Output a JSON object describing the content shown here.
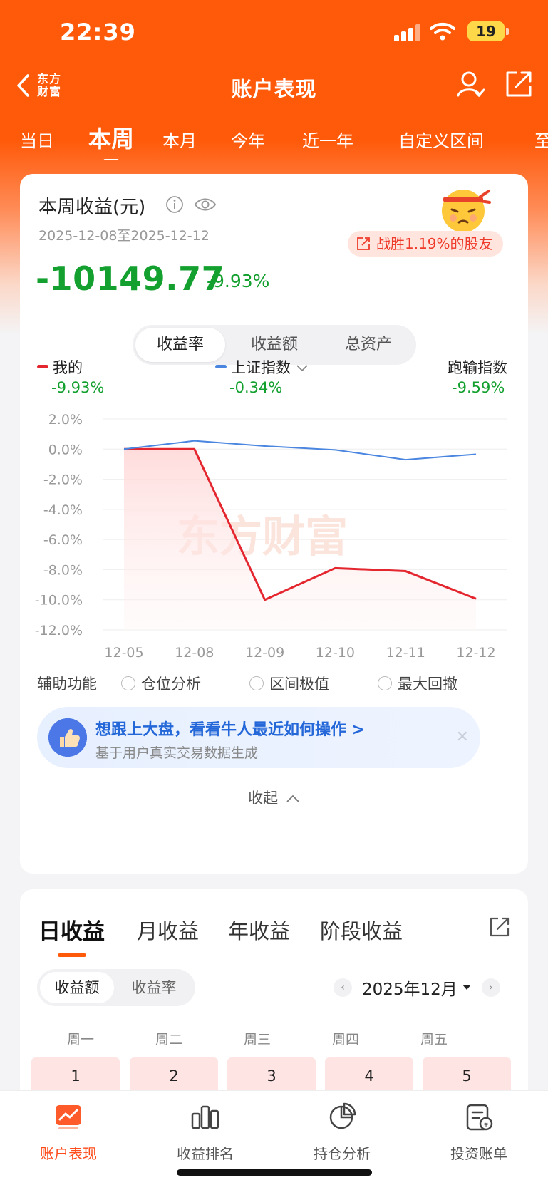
{
  "status_bar": {
    "time": "22:39",
    "battery": "19"
  },
  "navbar": {
    "logo_text": "东方财富",
    "title": "账户表现"
  },
  "period_tabs": [
    {
      "label": "当日"
    },
    {
      "label": "本周"
    },
    {
      "label": "本月"
    },
    {
      "label": "今年"
    },
    {
      "label": "近一年"
    },
    {
      "label": "自定义区间"
    },
    {
      "label": "至"
    }
  ],
  "summary": {
    "title": "本周收益(元)",
    "date_range": "2025-12-08至2025-12-12",
    "beat_text": "战胜1.19%的股友",
    "value": "-10149.77",
    "pct": "-9.93%"
  },
  "metric_tabs": [
    "收益率",
    "收益额",
    "总资产"
  ],
  "legend": [
    {
      "label": "我的",
      "value": "-9.93%",
      "color": "#e4262f"
    },
    {
      "label": "上证指数",
      "value": "-0.34%",
      "color": "#4a86e0"
    },
    {
      "label": "跑输指数",
      "value": "-9.59%"
    }
  ],
  "chart_data": {
    "type": "line",
    "x": [
      "12-05",
      "12-08",
      "12-09",
      "12-10",
      "12-11",
      "12-12"
    ],
    "ylim": [
      -12,
      2
    ],
    "yticks": [
      "2.0%",
      "0.0%",
      "-2.0%",
      "-4.0%",
      "-6.0%",
      "-8.0%",
      "-10.0%",
      "-12.0%"
    ],
    "grid": true,
    "watermark": "东方财富",
    "series": [
      {
        "name": "我的",
        "color": "#e4262f",
        "values": [
          0.0,
          0.0,
          -10.0,
          -7.9,
          -8.1,
          -9.93
        ],
        "fill": true
      },
      {
        "name": "上证指数",
        "color": "#4a86e0",
        "values": [
          0.0,
          0.55,
          0.2,
          -0.05,
          -0.7,
          -0.34
        ],
        "fill": false
      }
    ]
  },
  "aux": {
    "label": "辅助功能",
    "options": [
      "仓位分析",
      "区间极值",
      "最大回撤"
    ]
  },
  "promo": {
    "title": "想跟上大盘，看看牛人最近如何操作 >",
    "subtitle": "基于用户真实交易数据生成"
  },
  "collapse_label": "收起",
  "income_tabs": [
    "日收益",
    "月收益",
    "年收益",
    "阶段收益"
  ],
  "income_seg": [
    "收益额",
    "收益率"
  ],
  "month_label": "2025年12月",
  "weekdays": [
    "周一",
    "周二",
    "周三",
    "周四",
    "周五"
  ],
  "days": [
    "1",
    "2",
    "3",
    "4",
    "5"
  ],
  "bottom_nav": [
    {
      "label": "账户表现"
    },
    {
      "label": "收益排名"
    },
    {
      "label": "持仓分析"
    },
    {
      "label": "投资账单"
    }
  ]
}
